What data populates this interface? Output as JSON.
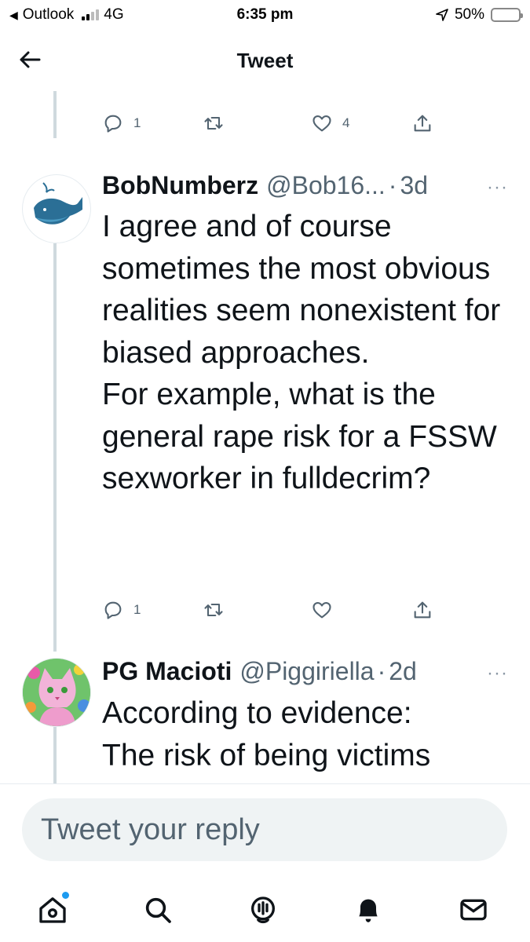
{
  "status_bar": {
    "back_app": "Outlook",
    "network": "4G",
    "time": "6:35 pm",
    "battery": "50%",
    "battery_level": 0.5,
    "battery_color": "#f4c430"
  },
  "header": {
    "title": "Tweet",
    "back_icon": "arrow-left-icon"
  },
  "tweets": [
    {
      "actions": {
        "reply_count": "1",
        "retweet_count": "",
        "like_count": "4"
      }
    },
    {
      "display_name": "BobNumberz",
      "handle": "@Bob16...",
      "dot": "·",
      "time": "3d",
      "more": "···",
      "body": "I agree and of course sometimes the most obvious realities seem nonexistent for biased approaches.\nFor example, what is the general rape risk for a FSSW sexworker in fulldecrim?",
      "avatar_icon": "whale-icon",
      "actions": {
        "reply_count": "1",
        "retweet_count": "",
        "like_count": ""
      }
    },
    {
      "display_name": "PG Macioti",
      "handle": "@Piggiriella",
      "dot": "·",
      "time": "2d",
      "more": "···",
      "body": "According to evidence:\nThe risk of being victims",
      "avatar_icon": "cat-avatar-icon"
    }
  ],
  "reply": {
    "placeholder": "Tweet your reply"
  },
  "bottom_nav": {
    "items": [
      "home-icon",
      "search-icon",
      "spaces-icon",
      "notifications-icon",
      "messages-icon"
    ],
    "accent": "#1d9bf0"
  }
}
